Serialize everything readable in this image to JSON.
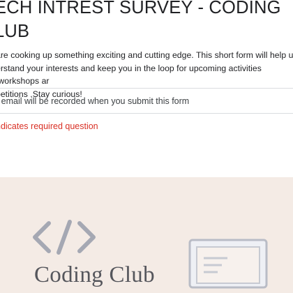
{
  "form": {
    "title_line1": "ECH INTREST SURVEY - CODING",
    "title_line2": "LUB",
    "description_line1": "are cooking up something exciting and cutting edge. This short form will help us",
    "description_line2": "erstand your interests and keep you in the loop for upcoming activities ,workshops ar",
    "description_line3": "petitions .Stay curious!",
    "email_notice": "r email will be recorded when you submit this form",
    "required_notice": "ndicates required question"
  },
  "banner": {
    "title": "Coding Club",
    "code_icon": "code-brackets-icon",
    "laptop_icon": "laptop-icon"
  },
  "colors": {
    "page_bg": "#f1ecf6",
    "card_bg": "#ffffff",
    "required": "#d93025",
    "banner_bg": "#f4ebe5",
    "icon_gray": "#a5a8b3"
  }
}
